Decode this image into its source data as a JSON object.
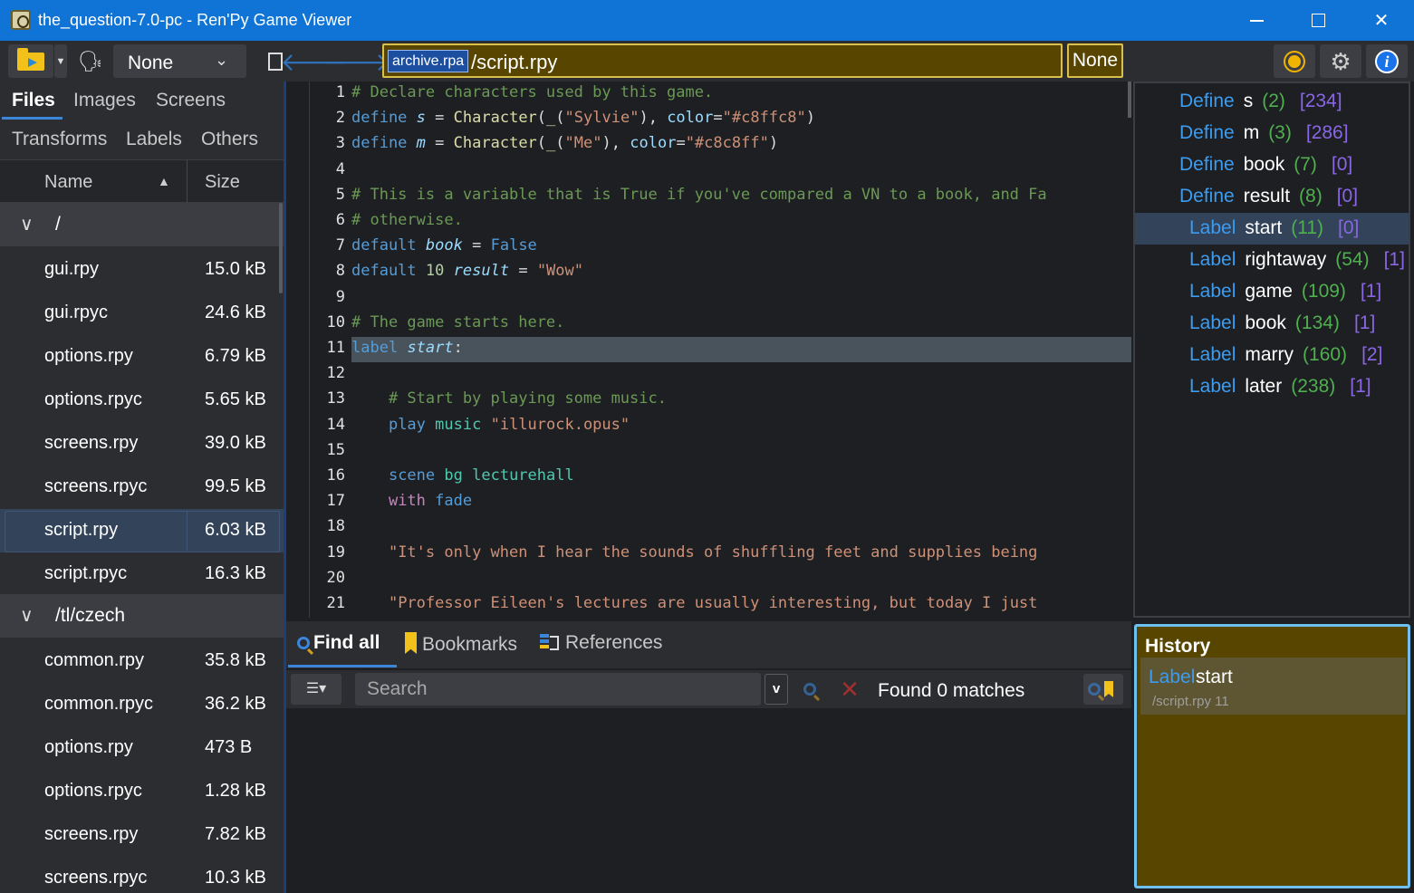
{
  "window": {
    "title": "the_question-7.0-pc - Ren'Py Game Viewer"
  },
  "toolbar": {
    "language": "None",
    "archive": "archive.rpa",
    "path": "/script.rpy",
    "label": "None"
  },
  "left_tabs": {
    "files": "Files",
    "images": "Images",
    "screens": "Screens",
    "transforms": "Transforms",
    "labels": "Labels",
    "others": "Others"
  },
  "file_columns": {
    "name": "Name",
    "size": "Size"
  },
  "groups": [
    {
      "name": "/",
      "files": [
        {
          "name": "gui.rpy",
          "size": "15.0 kB"
        },
        {
          "name": "gui.rpyc",
          "size": "24.6 kB"
        },
        {
          "name": "options.rpy",
          "size": "6.79 kB"
        },
        {
          "name": "options.rpyc",
          "size": "5.65 kB"
        },
        {
          "name": "screens.rpy",
          "size": "39.0 kB"
        },
        {
          "name": "screens.rpyc",
          "size": "99.5 kB"
        },
        {
          "name": "script.rpy",
          "size": "6.03 kB"
        },
        {
          "name": "script.rpyc",
          "size": "16.3 kB"
        }
      ]
    },
    {
      "name": "/tl/czech",
      "files": [
        {
          "name": "common.rpy",
          "size": "35.8 kB"
        },
        {
          "name": "common.rpyc",
          "size": "36.2 kB"
        },
        {
          "name": "options.rpy",
          "size": "473 B"
        },
        {
          "name": "options.rpyc",
          "size": "1.28 kB"
        },
        {
          "name": "screens.rpy",
          "size": "7.82 kB"
        },
        {
          "name": "screens.rpyc",
          "size": "10.3 kB"
        }
      ]
    }
  ],
  "code_lines": [
    {
      "n": "1",
      "t": "# Declare characters used by this game."
    },
    {
      "n": "2",
      "t": "define s = Character(_(\"Sylvie\"), color=\"#c8ffc8\")"
    },
    {
      "n": "3",
      "t": "define m = Character(_(\"Me\"), color=\"#c8c8ff\")"
    },
    {
      "n": "4",
      "t": ""
    },
    {
      "n": "5",
      "t": "# This is a variable that is True if you've compared a VN to a book, and Fa"
    },
    {
      "n": "6",
      "t": "# otherwise."
    },
    {
      "n": "7",
      "t": "default book = False"
    },
    {
      "n": "8",
      "t": "default 10 result = \"Wow\""
    },
    {
      "n": "9",
      "t": ""
    },
    {
      "n": "10",
      "t": "# The game starts here."
    },
    {
      "n": "11",
      "t": "label start:"
    },
    {
      "n": "12",
      "t": ""
    },
    {
      "n": "13",
      "t": "    # Start by playing some music."
    },
    {
      "n": "14",
      "t": "    play music \"illurock.opus\""
    },
    {
      "n": "15",
      "t": ""
    },
    {
      "n": "16",
      "t": "    scene bg lecturehall"
    },
    {
      "n": "17",
      "t": "    with fade"
    },
    {
      "n": "18",
      "t": ""
    },
    {
      "n": "19",
      "t": "    \"It's only when I hear the sounds of shuffling feet and supplies being"
    },
    {
      "n": "20",
      "t": ""
    },
    {
      "n": "21",
      "t": "    \"Professor Eileen's lectures are usually interesting, but today I just"
    }
  ],
  "outline": [
    {
      "kind": "Define",
      "name": "s",
      "line": "(2)",
      "refs": "[234]"
    },
    {
      "kind": "Define",
      "name": "m",
      "line": "(3)",
      "refs": "[286]"
    },
    {
      "kind": "Define",
      "name": "book",
      "line": "(7)",
      "refs": "[0]"
    },
    {
      "kind": "Define",
      "name": "result",
      "line": "(8)",
      "refs": "[0]"
    },
    {
      "kind": "Label",
      "name": "start",
      "line": "(11)",
      "refs": "[0]"
    },
    {
      "kind": "Label",
      "name": "rightaway",
      "line": "(54)",
      "refs": "[1]"
    },
    {
      "kind": "Label",
      "name": "game",
      "line": "(109)",
      "refs": "[1]"
    },
    {
      "kind": "Label",
      "name": "book",
      "line": "(134)",
      "refs": "[1]"
    },
    {
      "kind": "Label",
      "name": "marry",
      "line": "(160)",
      "refs": "[2]"
    },
    {
      "kind": "Label",
      "name": "later",
      "line": "(238)",
      "refs": "[1]"
    }
  ],
  "bottom_tabs": {
    "find": "Find all",
    "bookmarks": "Bookmarks",
    "references": "References"
  },
  "search": {
    "placeholder": "Search",
    "status": "Found 0 matches"
  },
  "history": {
    "title": "History",
    "kind": "Label",
    "name": "start",
    "location": "/script.rpy 11"
  },
  "colors": {
    "titlebar": "#0f74d6",
    "accent": "#3b86d8",
    "path_bg": "#574500",
    "path_border": "#d9c04a"
  }
}
